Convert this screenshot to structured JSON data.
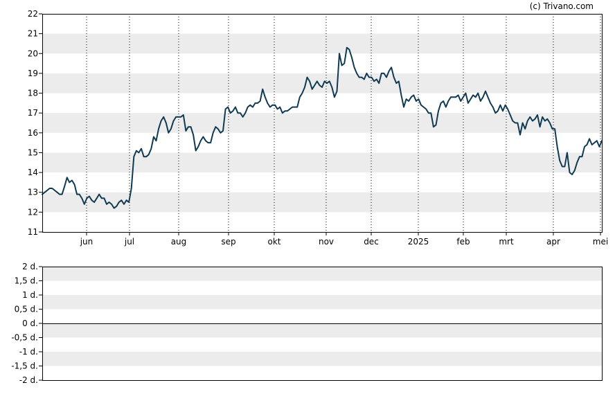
{
  "credit": "(c) Trivano.com",
  "colors": {
    "line": "#0f3a52",
    "band": "#ececec",
    "frame": "#000000",
    "vgrid": "#000000",
    "background": "#ffffff"
  },
  "chart_data": [
    {
      "type": "line",
      "title": "",
      "xlabel": "",
      "ylabel": "",
      "ylim": [
        11,
        22
      ],
      "y_ticks": [
        "11",
        "12",
        "13",
        "14",
        "15",
        "16",
        "17",
        "18",
        "19",
        "20",
        "21",
        "22"
      ],
      "x_ticks": [
        "jun",
        "jul",
        "aug",
        "sep",
        "okt",
        "nov",
        "dec",
        "2025",
        "feb",
        "mrt",
        "apr",
        "mei"
      ],
      "grid": "alternating horizontal bands, dotted vertical lines at month starts",
      "series": [
        {
          "name": "",
          "values": [
            12.9,
            13.0,
            13.1,
            13.2,
            13.2,
            13.1,
            13.0,
            12.9,
            12.9,
            13.3,
            13.75,
            13.5,
            13.6,
            13.4,
            12.9,
            12.9,
            12.7,
            12.4,
            12.7,
            12.8,
            12.6,
            12.5,
            12.7,
            12.9,
            12.7,
            12.7,
            12.4,
            12.5,
            12.4,
            12.2,
            12.3,
            12.5,
            12.6,
            12.4,
            12.6,
            12.5,
            13.2,
            14.8,
            15.1,
            15.0,
            15.2,
            14.8,
            14.8,
            14.9,
            15.2,
            15.8,
            15.6,
            16.2,
            16.6,
            16.8,
            16.5,
            16.0,
            16.2,
            16.6,
            16.8,
            16.8,
            16.8,
            16.9,
            16.1,
            16.3,
            16.3,
            15.9,
            15.1,
            15.3,
            15.6,
            15.8,
            15.6,
            15.5,
            15.5,
            16.0,
            16.3,
            16.2,
            16.0,
            16.1,
            17.2,
            17.3,
            17.0,
            17.1,
            17.3,
            17.0,
            17.0,
            16.8,
            17.0,
            17.3,
            17.4,
            17.3,
            17.5,
            17.5,
            17.6,
            18.2,
            17.8,
            17.5,
            17.3,
            17.4,
            17.4,
            17.2,
            17.3,
            17.0,
            17.1,
            17.1,
            17.2,
            17.3,
            17.3,
            17.3,
            17.8,
            18.0,
            18.3,
            18.8,
            18.6,
            18.2,
            18.4,
            18.6,
            18.4,
            18.3,
            18.6,
            18.5,
            18.6,
            18.3,
            17.8,
            18.1,
            20.0,
            19.4,
            19.5,
            20.3,
            20.2,
            19.8,
            19.3,
            19.0,
            18.8,
            18.8,
            18.7,
            19.0,
            18.8,
            18.8,
            18.6,
            18.7,
            18.5,
            19.0,
            19.0,
            18.8,
            19.1,
            19.3,
            18.8,
            18.5,
            18.6,
            17.9,
            17.3,
            17.7,
            17.6,
            17.8,
            17.9,
            17.6,
            17.7,
            17.4,
            17.3,
            17.2,
            17.0,
            17.0,
            16.3,
            16.4,
            17.1,
            17.5,
            17.6,
            17.3,
            17.6,
            17.8,
            17.8,
            17.8,
            17.9,
            17.6,
            17.8,
            18.0,
            17.5,
            17.7,
            17.9,
            17.8,
            18.0,
            17.6,
            17.8,
            18.1,
            17.8,
            17.5,
            17.3,
            17.0,
            17.1,
            17.4,
            17.1,
            17.4,
            17.2,
            16.9,
            16.6,
            16.5,
            16.5,
            15.9,
            16.5,
            16.2,
            16.6,
            16.8,
            16.6,
            16.7,
            16.9,
            16.3,
            16.8,
            16.6,
            16.7,
            16.5,
            16.2,
            16.2,
            15.3,
            14.6,
            14.3,
            14.3,
            15.0,
            14.0,
            13.9,
            14.1,
            14.5,
            14.8,
            14.8,
            15.3,
            15.4,
            15.7,
            15.4,
            15.5,
            15.6,
            15.3,
            15.6
          ]
        }
      ]
    },
    {
      "type": "bar",
      "title": "",
      "xlabel": "",
      "ylabel": "",
      "ylim": [
        -2,
        2
      ],
      "y_ticks": [
        "2 d.",
        "1,5 d.",
        "1 d.",
        "0,5 d.",
        "0 d.",
        "-0,5 d.",
        "-1 d.",
        "-1,5 d.",
        "-2 d."
      ],
      "grid": "alternating horizontal bands",
      "series": []
    }
  ]
}
